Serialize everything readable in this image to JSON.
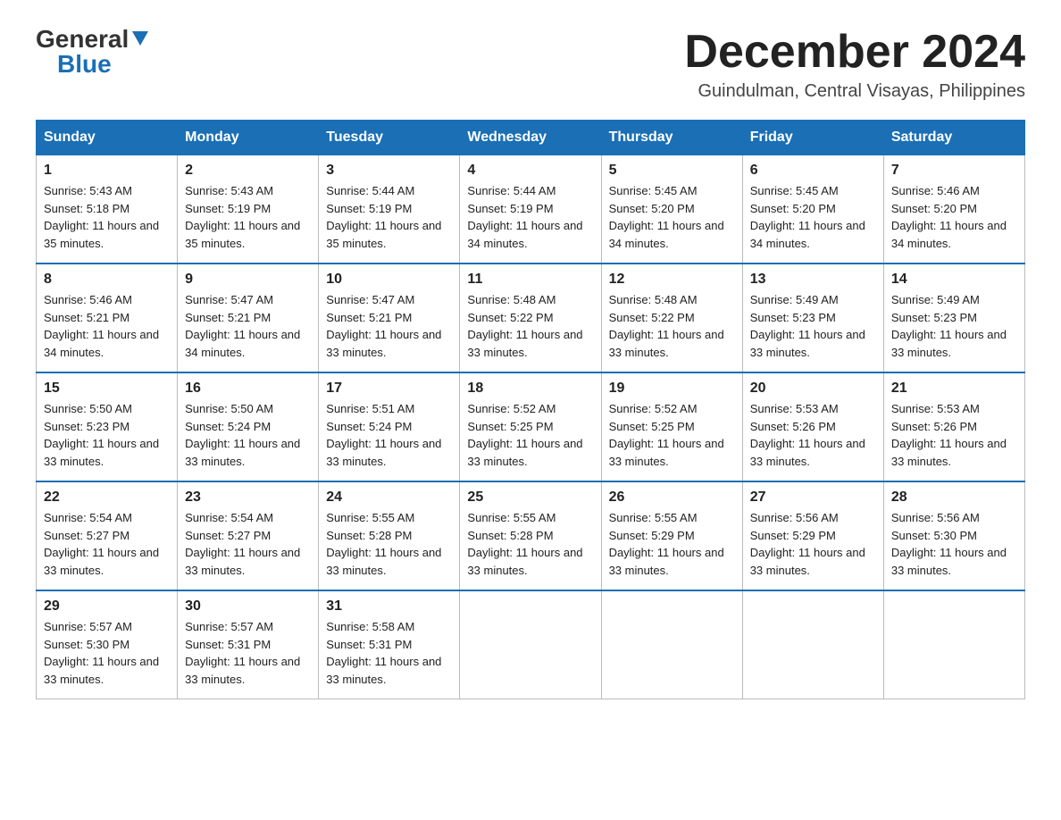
{
  "logo": {
    "general": "General",
    "blue": "Blue"
  },
  "title": "December 2024",
  "location": "Guindulman, Central Visayas, Philippines",
  "days_of_week": [
    "Sunday",
    "Monday",
    "Tuesday",
    "Wednesday",
    "Thursday",
    "Friday",
    "Saturday"
  ],
  "weeks": [
    [
      {
        "day": "1",
        "sunrise": "Sunrise: 5:43 AM",
        "sunset": "Sunset: 5:18 PM",
        "daylight": "Daylight: 11 hours and 35 minutes."
      },
      {
        "day": "2",
        "sunrise": "Sunrise: 5:43 AM",
        "sunset": "Sunset: 5:19 PM",
        "daylight": "Daylight: 11 hours and 35 minutes."
      },
      {
        "day": "3",
        "sunrise": "Sunrise: 5:44 AM",
        "sunset": "Sunset: 5:19 PM",
        "daylight": "Daylight: 11 hours and 35 minutes."
      },
      {
        "day": "4",
        "sunrise": "Sunrise: 5:44 AM",
        "sunset": "Sunset: 5:19 PM",
        "daylight": "Daylight: 11 hours and 34 minutes."
      },
      {
        "day": "5",
        "sunrise": "Sunrise: 5:45 AM",
        "sunset": "Sunset: 5:20 PM",
        "daylight": "Daylight: 11 hours and 34 minutes."
      },
      {
        "day": "6",
        "sunrise": "Sunrise: 5:45 AM",
        "sunset": "Sunset: 5:20 PM",
        "daylight": "Daylight: 11 hours and 34 minutes."
      },
      {
        "day": "7",
        "sunrise": "Sunrise: 5:46 AM",
        "sunset": "Sunset: 5:20 PM",
        "daylight": "Daylight: 11 hours and 34 minutes."
      }
    ],
    [
      {
        "day": "8",
        "sunrise": "Sunrise: 5:46 AM",
        "sunset": "Sunset: 5:21 PM",
        "daylight": "Daylight: 11 hours and 34 minutes."
      },
      {
        "day": "9",
        "sunrise": "Sunrise: 5:47 AM",
        "sunset": "Sunset: 5:21 PM",
        "daylight": "Daylight: 11 hours and 34 minutes."
      },
      {
        "day": "10",
        "sunrise": "Sunrise: 5:47 AM",
        "sunset": "Sunset: 5:21 PM",
        "daylight": "Daylight: 11 hours and 33 minutes."
      },
      {
        "day": "11",
        "sunrise": "Sunrise: 5:48 AM",
        "sunset": "Sunset: 5:22 PM",
        "daylight": "Daylight: 11 hours and 33 minutes."
      },
      {
        "day": "12",
        "sunrise": "Sunrise: 5:48 AM",
        "sunset": "Sunset: 5:22 PM",
        "daylight": "Daylight: 11 hours and 33 minutes."
      },
      {
        "day": "13",
        "sunrise": "Sunrise: 5:49 AM",
        "sunset": "Sunset: 5:23 PM",
        "daylight": "Daylight: 11 hours and 33 minutes."
      },
      {
        "day": "14",
        "sunrise": "Sunrise: 5:49 AM",
        "sunset": "Sunset: 5:23 PM",
        "daylight": "Daylight: 11 hours and 33 minutes."
      }
    ],
    [
      {
        "day": "15",
        "sunrise": "Sunrise: 5:50 AM",
        "sunset": "Sunset: 5:23 PM",
        "daylight": "Daylight: 11 hours and 33 minutes."
      },
      {
        "day": "16",
        "sunrise": "Sunrise: 5:50 AM",
        "sunset": "Sunset: 5:24 PM",
        "daylight": "Daylight: 11 hours and 33 minutes."
      },
      {
        "day": "17",
        "sunrise": "Sunrise: 5:51 AM",
        "sunset": "Sunset: 5:24 PM",
        "daylight": "Daylight: 11 hours and 33 minutes."
      },
      {
        "day": "18",
        "sunrise": "Sunrise: 5:52 AM",
        "sunset": "Sunset: 5:25 PM",
        "daylight": "Daylight: 11 hours and 33 minutes."
      },
      {
        "day": "19",
        "sunrise": "Sunrise: 5:52 AM",
        "sunset": "Sunset: 5:25 PM",
        "daylight": "Daylight: 11 hours and 33 minutes."
      },
      {
        "day": "20",
        "sunrise": "Sunrise: 5:53 AM",
        "sunset": "Sunset: 5:26 PM",
        "daylight": "Daylight: 11 hours and 33 minutes."
      },
      {
        "day": "21",
        "sunrise": "Sunrise: 5:53 AM",
        "sunset": "Sunset: 5:26 PM",
        "daylight": "Daylight: 11 hours and 33 minutes."
      }
    ],
    [
      {
        "day": "22",
        "sunrise": "Sunrise: 5:54 AM",
        "sunset": "Sunset: 5:27 PM",
        "daylight": "Daylight: 11 hours and 33 minutes."
      },
      {
        "day": "23",
        "sunrise": "Sunrise: 5:54 AM",
        "sunset": "Sunset: 5:27 PM",
        "daylight": "Daylight: 11 hours and 33 minutes."
      },
      {
        "day": "24",
        "sunrise": "Sunrise: 5:55 AM",
        "sunset": "Sunset: 5:28 PM",
        "daylight": "Daylight: 11 hours and 33 minutes."
      },
      {
        "day": "25",
        "sunrise": "Sunrise: 5:55 AM",
        "sunset": "Sunset: 5:28 PM",
        "daylight": "Daylight: 11 hours and 33 minutes."
      },
      {
        "day": "26",
        "sunrise": "Sunrise: 5:55 AM",
        "sunset": "Sunset: 5:29 PM",
        "daylight": "Daylight: 11 hours and 33 minutes."
      },
      {
        "day": "27",
        "sunrise": "Sunrise: 5:56 AM",
        "sunset": "Sunset: 5:29 PM",
        "daylight": "Daylight: 11 hours and 33 minutes."
      },
      {
        "day": "28",
        "sunrise": "Sunrise: 5:56 AM",
        "sunset": "Sunset: 5:30 PM",
        "daylight": "Daylight: 11 hours and 33 minutes."
      }
    ],
    [
      {
        "day": "29",
        "sunrise": "Sunrise: 5:57 AM",
        "sunset": "Sunset: 5:30 PM",
        "daylight": "Daylight: 11 hours and 33 minutes."
      },
      {
        "day": "30",
        "sunrise": "Sunrise: 5:57 AM",
        "sunset": "Sunset: 5:31 PM",
        "daylight": "Daylight: 11 hours and 33 minutes."
      },
      {
        "day": "31",
        "sunrise": "Sunrise: 5:58 AM",
        "sunset": "Sunset: 5:31 PM",
        "daylight": "Daylight: 11 hours and 33 minutes."
      },
      null,
      null,
      null,
      null
    ]
  ]
}
